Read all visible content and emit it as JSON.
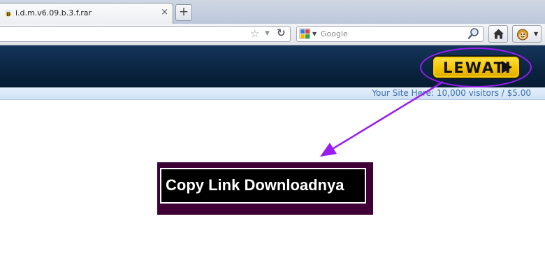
{
  "browser": {
    "tab": {
      "title": "i.d.m.v6.09.b.3.f.rar",
      "close": "×"
    },
    "new_tab": "+",
    "search": {
      "placeholder": "Google"
    }
  },
  "ad": {
    "skip_label": "LEWATI",
    "banner_text": "Your Site Here: 10,000 visitors / $5.00"
  },
  "content": {
    "download_label": "Copy Link Downloadnya"
  },
  "colors": {
    "header": "#0b2846",
    "skip_yellow": "#f4c400",
    "annotation": "#9a1df0",
    "box_border": "#3f0036"
  },
  "icons": [
    "bee-favicon-icon",
    "star-icon",
    "dropdown-icon",
    "reload-icon",
    "google-icon",
    "magnifier-icon",
    "home-icon",
    "addon-face-icon",
    "play-arrow-icon",
    "annotation-arrow-icon"
  ]
}
